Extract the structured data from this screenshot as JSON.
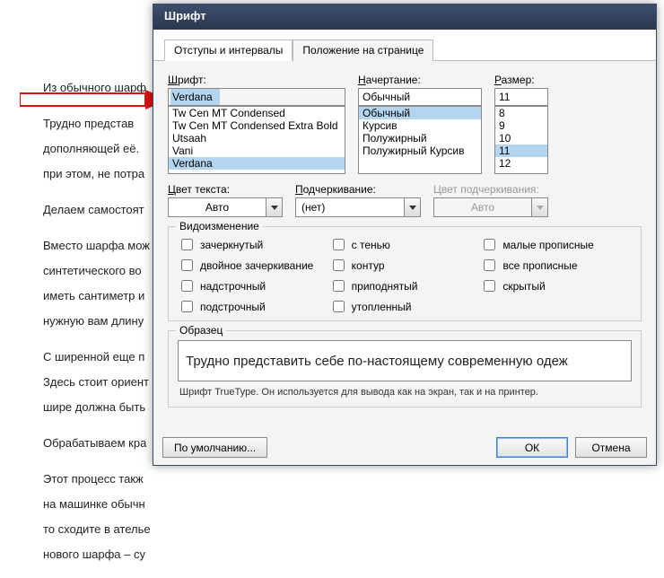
{
  "page_text": [
    "Из обычного шарф",
    "Трудно представ",
    "дополняющей её.",
    "при этом, не потра",
    "Делаем самостоят",
    "Вместо шарфа мож",
    "синтетического во",
    "иметь сантиметр и",
    "нужную вам длину",
    " С ширенной еще п",
    "Здесь стоит ориент",
    "шире должна быть",
    "Обрабатываем кра",
    "Этот процесс такж",
    "на машинке обычн",
    "то сходите в ателье",
    "нового шарфа – су"
  ],
  "dialog": {
    "title": "Шрифт",
    "tabs": {
      "indents": "Отступы и интервалы",
      "position": "Положение на странице"
    },
    "font": {
      "label": "Шрифт:",
      "u": "Ш",
      "value": "Verdana",
      "list": [
        "Tw Cen MT Condensed",
        "Tw Cen MT Condensed Extra Bold",
        "Utsaah",
        "Vani",
        "Verdana"
      ]
    },
    "style": {
      "label": "Начертание:",
      "u": "Н",
      "value": "Обычный",
      "list": [
        "Обычный",
        "Курсив",
        "Полужирный",
        "Полужирный Курсив"
      ]
    },
    "size": {
      "label": "Размер:",
      "u": "Р",
      "value": "11",
      "list": [
        "8",
        "9",
        "10",
        "11",
        "12"
      ]
    },
    "color": {
      "label": "Цвет текста:",
      "u": "Ц",
      "value": "Авто"
    },
    "underline": {
      "label": "Подчеркивание:",
      "u": "П",
      "value": "(нет)"
    },
    "ulcolor": {
      "label": "Цвет подчеркивания:",
      "value": "Авто"
    },
    "effects": {
      "legend": "Видоизменение",
      "items": {
        "strike": "зачеркнутый",
        "strike_u": "з",
        "shadow": "с тенью",
        "shadow_u": "т",
        "smallcaps": "малые прописные",
        "smallcaps_u": "м",
        "dstrike": "двойное зачеркивание",
        "dstrike_u": "д",
        "outline": "контур",
        "outline_u": "к",
        "allcaps": "все прописные",
        "allcaps_u": "в",
        "supers": "надстрочный",
        "supers_u": "н",
        "emboss": "приподнятый",
        "emboss_u": "п",
        "hidden": "скрытый",
        "hidden_u": "с",
        "subs": "подстрочный",
        "subs_u": "о",
        "engrave": "утопленный",
        "engrave_u": "у"
      }
    },
    "sample": {
      "legend": "Образец",
      "text": "Трудно представить себе по-настоящему современную одеж"
    },
    "hint": "Шрифт TrueType. Он используется для вывода как на экран, так и на принтер.",
    "buttons": {
      "default": "По умолчанию...",
      "default_u": "у",
      "ok": "ОК",
      "cancel": "Отмена"
    }
  }
}
